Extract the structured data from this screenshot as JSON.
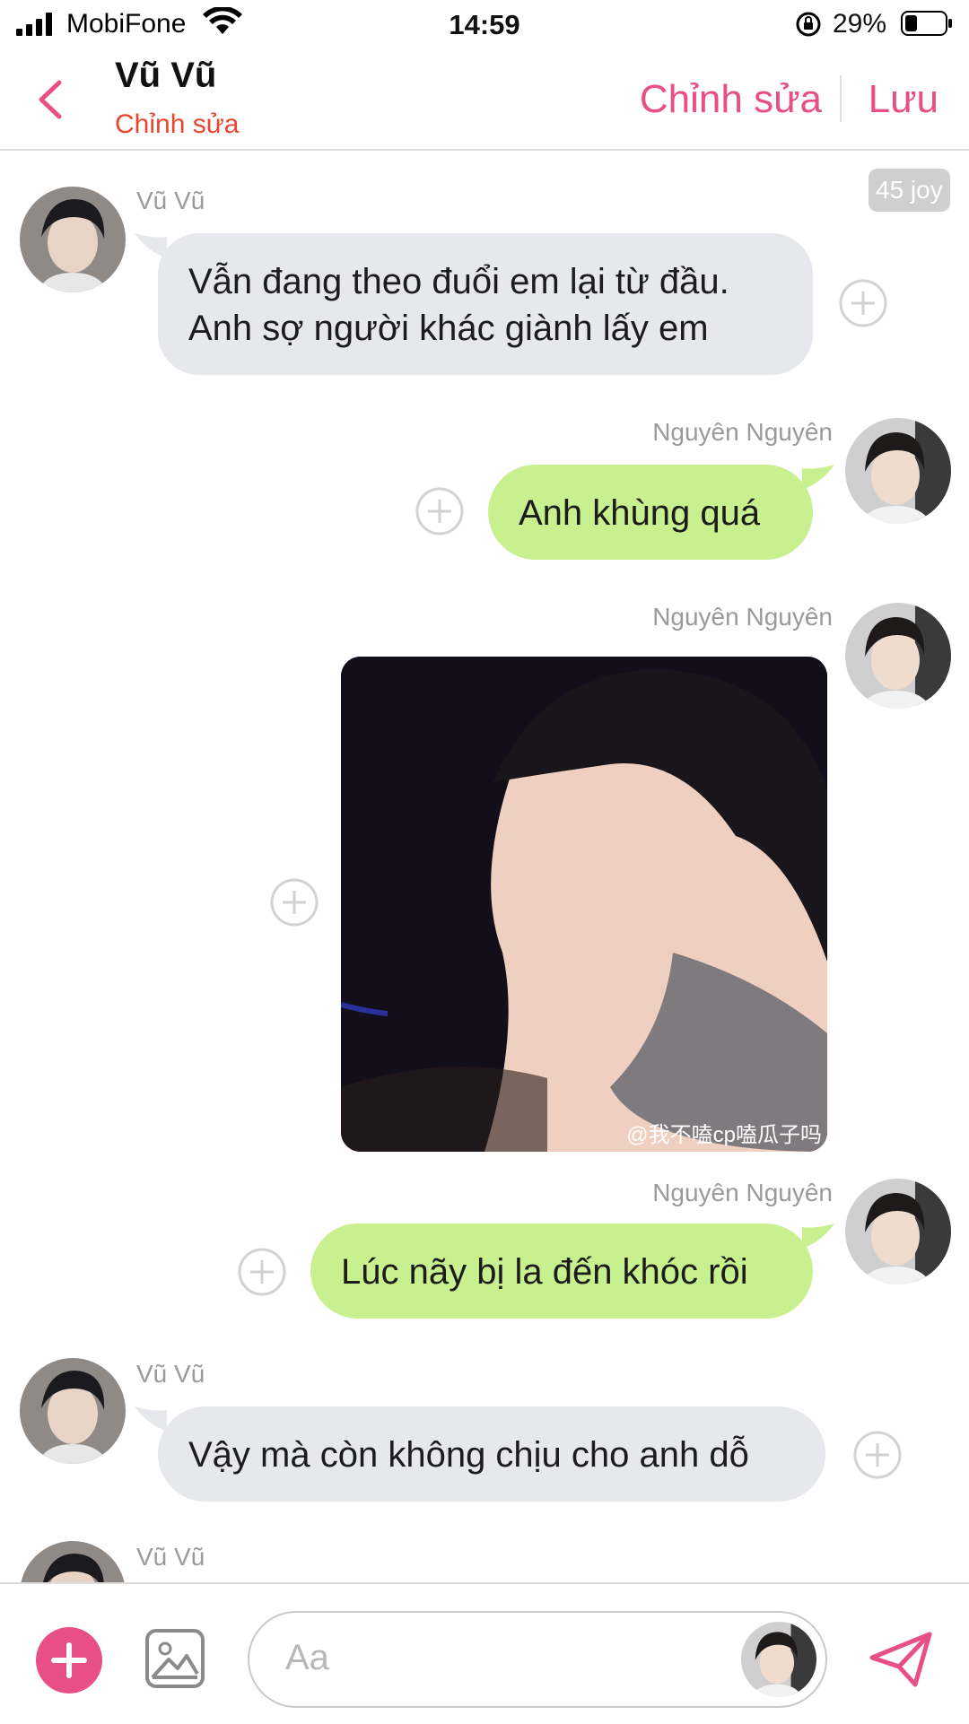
{
  "status_bar": {
    "carrier": "MobiFone",
    "time": "14:59",
    "battery": "29%"
  },
  "header": {
    "title": "Vũ Vũ",
    "subtitle": "Chỉnh sửa",
    "edit_label": "Chỉnh sửa",
    "save_label": "Lưu"
  },
  "chat": {
    "joy_badge": "45 joy",
    "messages": [
      {
        "sender": "Vũ Vũ",
        "side": "left",
        "lines": [
          "Vẫn đang theo đuổi em lại từ đầu.",
          "Anh sợ người khác giành lấy em"
        ]
      },
      {
        "sender": "Nguyên Nguyên",
        "side": "right",
        "text": "Anh khùng quá"
      },
      {
        "sender": "Nguyên Nguyên",
        "side": "right",
        "type": "image",
        "watermark": "@我不嗑cp嗑瓜子吗"
      },
      {
        "sender": "Nguyên Nguyên",
        "side": "right",
        "text": "Lúc nãy bị la đến khóc rồi"
      },
      {
        "sender": "Vũ Vũ",
        "side": "left",
        "text": "Vậy mà còn không chịu cho anh dỗ"
      },
      {
        "sender": "Vũ Vũ",
        "side": "left",
        "text": ""
      }
    ]
  },
  "composer": {
    "placeholder": "Aa"
  },
  "colors": {
    "accent": "#e94f87",
    "subtitle": "#e8452f",
    "outgoing_bubble": "#c9f08f",
    "incoming_bubble": "#e6e8eb"
  },
  "icons": {
    "back": "chevron-left-icon",
    "add_reaction": "plus-circle-icon",
    "add": "plus-icon",
    "image": "image-icon",
    "send": "paper-plane-icon"
  }
}
